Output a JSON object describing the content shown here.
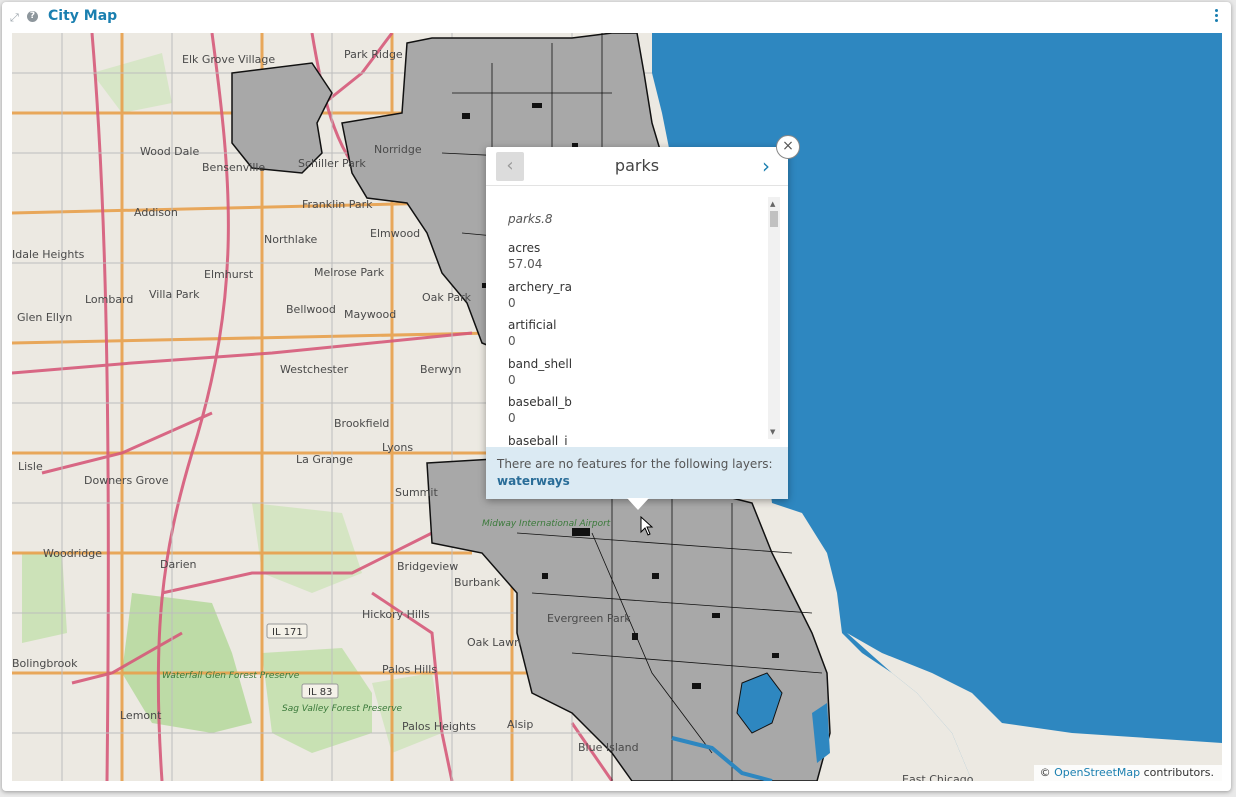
{
  "header": {
    "title": "City Map",
    "expand_icon": "expand-icon",
    "help_icon": "help-icon",
    "menu_icon": "kebab-menu-icon"
  },
  "map": {
    "water_color": "#2e87c0",
    "polygon_color": "#a8a8a8",
    "places": [
      "Elk Grove Village",
      "Park Ridge",
      "Wood Dale",
      "Bensenville",
      "Schiller Park",
      "Norridge",
      "Addison",
      "Franklin Park",
      "Elmwood",
      "Northlake",
      "Melrose Park",
      "Elmhurst",
      "Villa Park",
      "Lombard",
      "Oak Park",
      "Bellwood",
      "Maywood",
      "Glen Ellyn",
      "Westchester",
      "Berwyn",
      "Brookfield",
      "Lyons",
      "La Grange",
      "Lisle",
      "Downers Grove",
      "Summit",
      "Woodridge",
      "Darien",
      "Bridgeview",
      "Burbank",
      "Hickory Hills",
      "Oak Lawn",
      "Evergreen Park",
      "Palos Hills",
      "Palos Heights",
      "Alsip",
      "Blue Island",
      "Lemont",
      "Bolingbrook",
      "East Chicago",
      "Idale Heights",
      "Midway International Airport",
      "Waterfall Glen Forest Preserve",
      "Sag Valley Forest Preserve"
    ],
    "shields": [
      "IL 171",
      "IL 83"
    ],
    "attribution_prefix": "©",
    "attribution_link": "OpenStreetMap",
    "attribution_suffix": "contributors."
  },
  "popup": {
    "title": "parks",
    "prev_label": "‹",
    "next_label": "›",
    "close_label": "×",
    "feature_id": "parks.8",
    "properties": [
      {
        "key": "acres",
        "value": "57.04"
      },
      {
        "key": "archery_ra",
        "value": "0"
      },
      {
        "key": "artificial",
        "value": "0"
      },
      {
        "key": "band_shell",
        "value": "0"
      },
      {
        "key": "baseball_b",
        "value": "0"
      },
      {
        "key": "baseball_j",
        "value": ""
      }
    ],
    "no_features_text": "There are no features for the following layers:",
    "no_features_layer": "waterways"
  }
}
